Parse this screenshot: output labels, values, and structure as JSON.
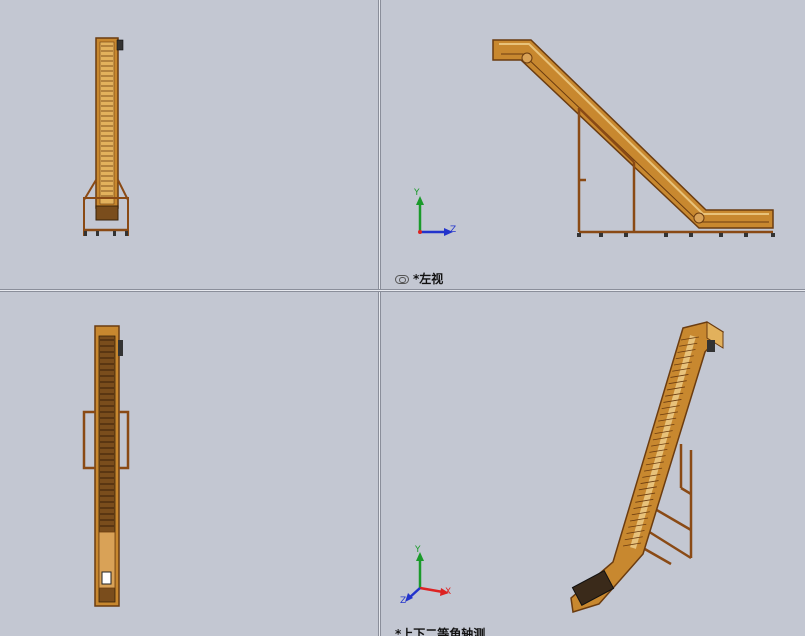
{
  "viewports": {
    "top_right": {
      "label": "*左视"
    },
    "bottom_right": {
      "label": "*上下二等角轴测"
    }
  },
  "triad": {
    "y": "Y",
    "z": "Z",
    "x": "X"
  },
  "colors": {
    "background": "#c3c7d2",
    "model": "#c8882f",
    "model_dark": "#6b3c10",
    "frame": "#8a4a15",
    "axis_x": "#d22",
    "axis_y": "#1a9a2a",
    "axis_z": "#2233cc"
  }
}
